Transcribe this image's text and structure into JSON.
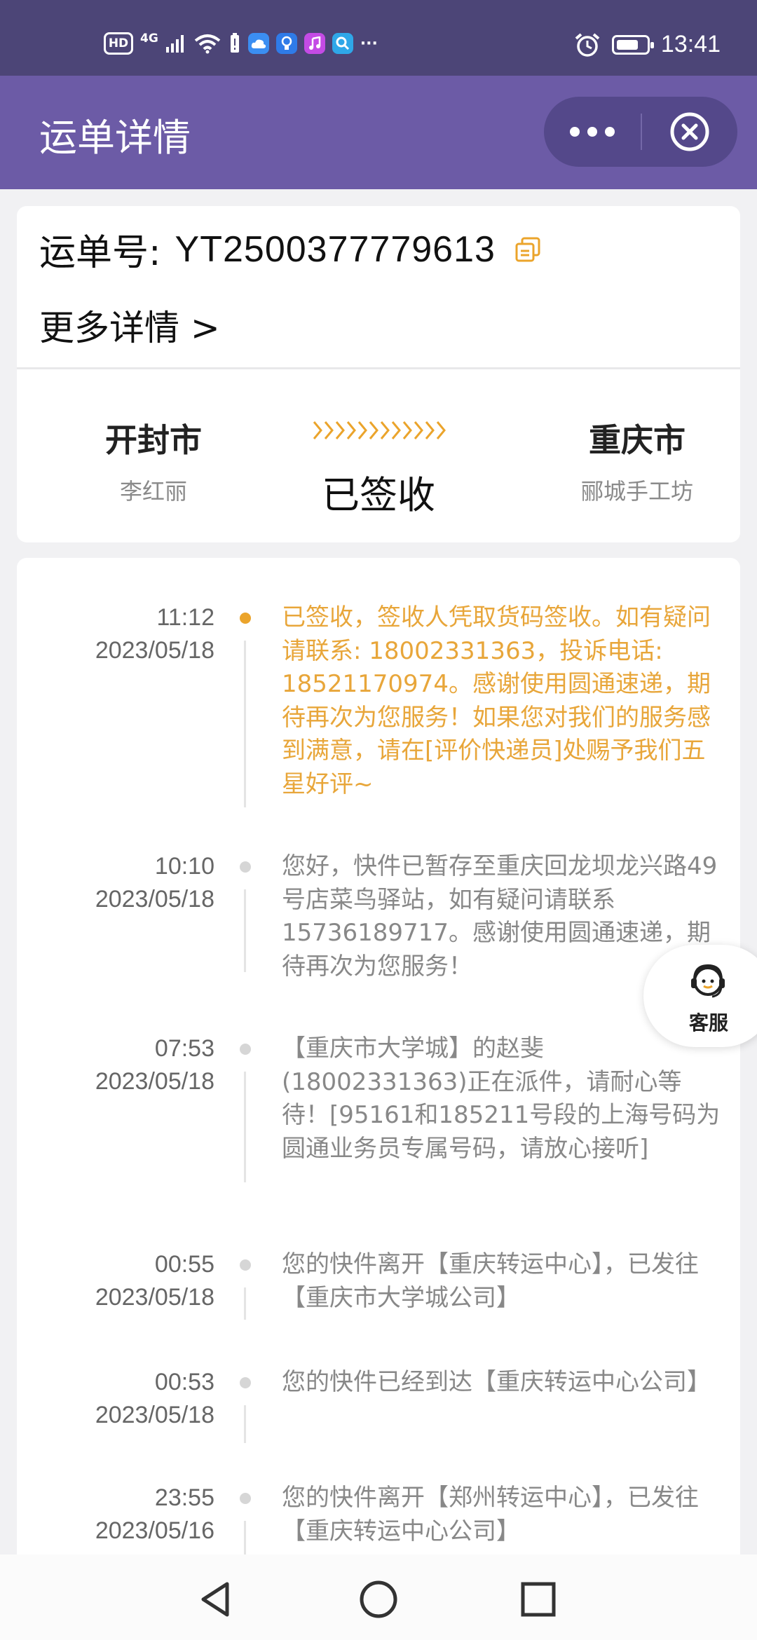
{
  "status_bar": {
    "hd_label": "HD",
    "network_label": "4G",
    "more_label": "···",
    "time": "13:41",
    "app_icon_colors": [
      "#3b8ef2",
      "#2f7be8",
      "#c44be5",
      "#2fa7e8"
    ]
  },
  "header": {
    "title": "运单详情",
    "more_icon": "more-dots-icon",
    "close_icon": "close-circle-icon"
  },
  "waybill": {
    "label": "运单号:",
    "number": "YT2500377779613",
    "more_details": "更多详情 >",
    "from_city": "开封市",
    "from_person": "李红丽",
    "to_city": "重庆市",
    "to_person": "郦城手工坊",
    "status": "已签收",
    "accent_color": "#eba42b"
  },
  "timeline": [
    {
      "time": "11:12",
      "date": "2023/05/18",
      "text": "已签收，签收人凭取货码签收。如有疑问请联系: 18002331363，投诉电话: 18521170974。感谢使用圆通速递，期待再次为您服务！如果您对我们的服务感到满意，请在[评价快递员]处赐予我们五星好评~",
      "active": true
    },
    {
      "time": "10:10",
      "date": "2023/05/18",
      "text": "您好，快件已暂存至重庆回龙坝龙兴路49号店菜鸟驿站，如有疑问请联系15736189717。感谢使用圆通速递，期待再次为您服务！",
      "active": false
    },
    {
      "time": "07:53",
      "date": "2023/05/18",
      "text": "【重庆市大学城】的赵斐(18002331363)正在派件，请耐心等待！[95161和185211号段的上海号码为圆通业务员专属号码，请放心接听]",
      "active": false
    },
    {
      "time": "00:55",
      "date": "2023/05/18",
      "text": "您的快件离开【重庆转运中心】，已发往【重庆市大学城公司】",
      "active": false
    },
    {
      "time": "00:53",
      "date": "2023/05/18",
      "text": "您的快件已经到达【重庆转运中心公司】",
      "active": false
    },
    {
      "time": "23:55",
      "date": "2023/05/16",
      "text": "您的快件离开【郑州转运中心】，已发往【重庆转运中心公司】",
      "active": false
    }
  ],
  "customer_service": {
    "label": "客服",
    "icon": "customer-service-icon"
  },
  "navigation": {
    "back_icon": "back-triangle-icon",
    "home_icon": "home-circle-icon",
    "recents_icon": "recents-square-icon"
  }
}
